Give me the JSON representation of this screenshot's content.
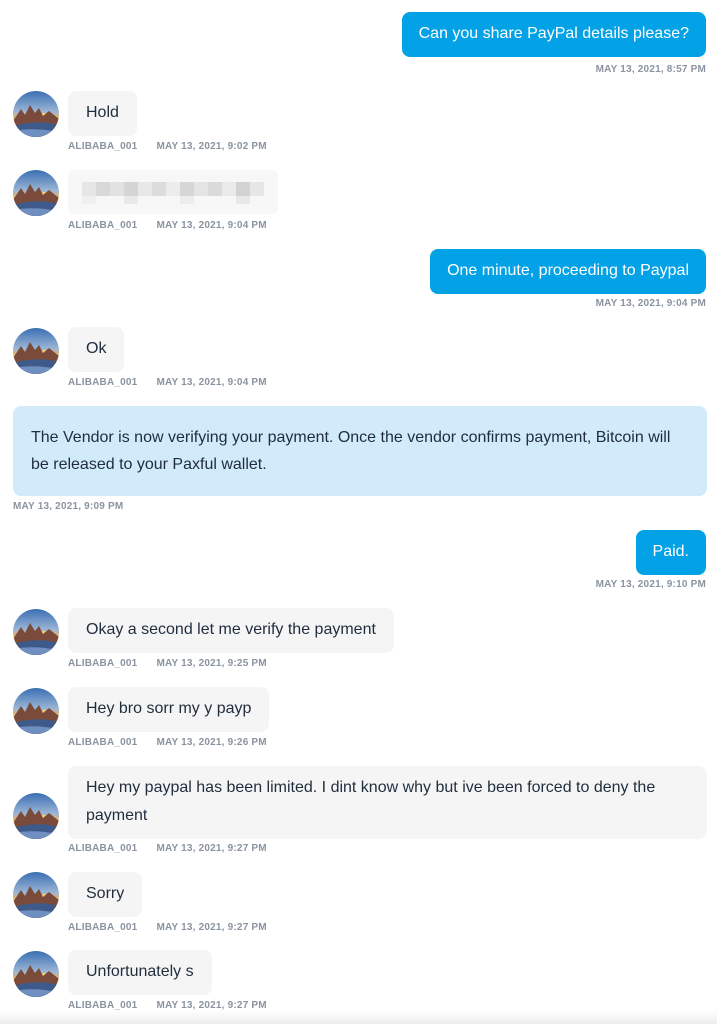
{
  "messages": {
    "m1": {
      "text": "Can you share PayPal details please?",
      "time": "MAY 13, 2021, 8:57 PM"
    },
    "m2": {
      "text": "Hold",
      "user": "ALIBABA_001",
      "time": "MAY 13, 2021, 9:02 PM"
    },
    "m3": {
      "user": "ALIBABA_001",
      "time": "MAY 13, 2021, 9:04 PM"
    },
    "m4": {
      "text": "One minute, proceeding to Paypal",
      "time": "MAY 13, 2021, 9:04 PM"
    },
    "m5": {
      "text": "Ok",
      "user": "ALIBABA_001",
      "time": "MAY 13, 2021, 9:04 PM"
    },
    "system": {
      "text": "The Vendor is now verifying your payment. Once the vendor confirms payment, Bitcoin will be released to your Paxful wallet.",
      "time": "MAY 13, 2021, 9:09 PM"
    },
    "m6": {
      "text": "Paid.",
      "time": "MAY 13, 2021, 9:10 PM"
    },
    "m7": {
      "text": "Okay a second let me verify the payment",
      "user": "ALIBABA_001",
      "time": "MAY 13, 2021, 9:25 PM"
    },
    "m8": {
      "text": "Hey bro sorr my y payp",
      "user": "ALIBABA_001",
      "time": "MAY 13, 2021, 9:26 PM"
    },
    "m9": {
      "text": "Hey my paypal has been limited. I dint know why but ive been forced to deny the payment",
      "user": "ALIBABA_001",
      "time": "MAY 13, 2021, 9:27 PM"
    },
    "m10": {
      "text": "Sorry",
      "user": "ALIBABA_001",
      "time": "MAY 13, 2021, 9:27 PM"
    },
    "m11": {
      "text": "Unfortunately s",
      "user": "ALIBABA_001",
      "time": "MAY 13, 2021, 9:27 PM"
    }
  },
  "colors": {
    "outgoing_bubble": "#03a2e6",
    "incoming_bubble": "#f5f5f5",
    "system_bubble": "#d1ebfb",
    "meta_text": "#8a94a0"
  },
  "icons": {
    "avatar": "sunset-landscape-avatar"
  }
}
